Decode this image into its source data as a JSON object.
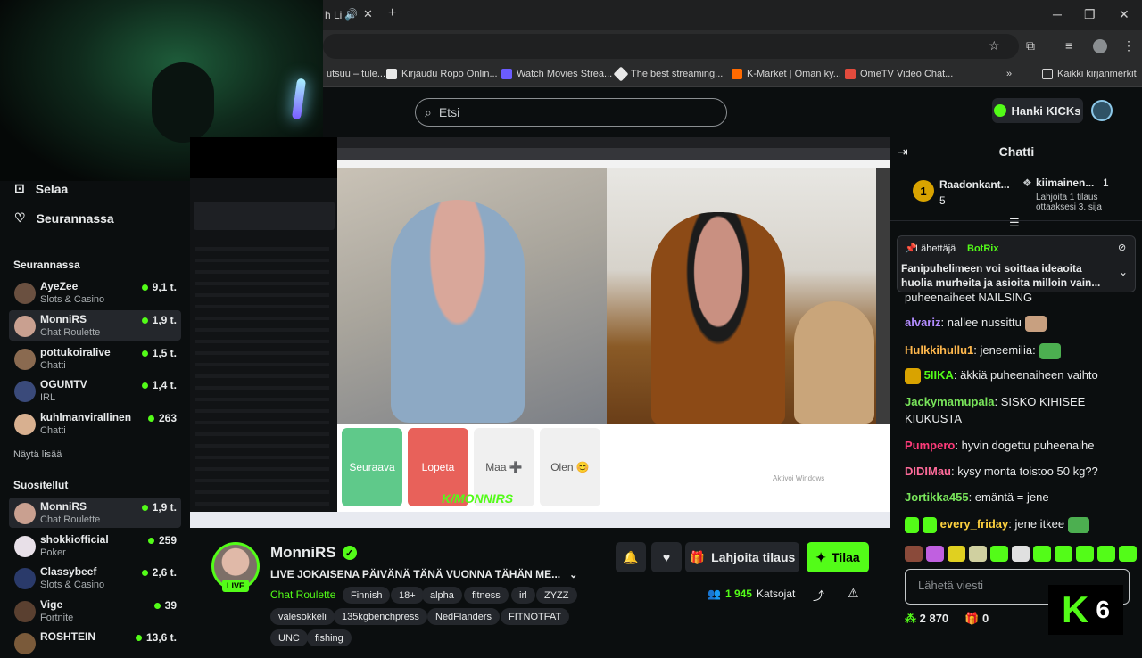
{
  "browser": {
    "tab_partial": "h Li",
    "bookmarks": [
      {
        "label": "utsuu – tule...",
        "color": "#3a3b3c"
      },
      {
        "label": "Kirjaudu Ropo Onlin...",
        "color": "#ffffff"
      },
      {
        "label": "Watch Movies Strea...",
        "color": "#6b5cff"
      },
      {
        "label": "The best streaming...",
        "color": "#ffffff"
      },
      {
        "label": "K-Market | Oman ky...",
        "color": "#ff6a00"
      },
      {
        "label": "OmeTV Video Chat...",
        "color": "#e34b3d"
      }
    ],
    "all_bookmarks": "Kaikki kirjanmerkit"
  },
  "site": {
    "search_placeholder": "Etsi",
    "get_kicks": "Hanki KICKs"
  },
  "sidebar": {
    "browse": "Selaa",
    "following": "Seurannassa",
    "following_header": "Seurannassa",
    "following_channels": [
      {
        "name": "AyeZee",
        "category": "Slots & Casino",
        "viewers": "9,1 t.",
        "color": "#6a5040"
      },
      {
        "name": "MonniRS",
        "category": "Chat Roulette",
        "viewers": "1,9 t.",
        "color": "#c9a090"
      },
      {
        "name": "pottukoiralive",
        "category": "Chatti",
        "viewers": "1,5 t.",
        "color": "#8a6a50"
      },
      {
        "name": "OGUMTV",
        "category": "IRL",
        "viewers": "1,4 t.",
        "color": "#3a4a7a"
      },
      {
        "name": "kuhlmanvirallinen",
        "category": "Chatti",
        "viewers": "263",
        "color": "#d8b090"
      }
    ],
    "show_more": "Näytä lisää",
    "recommended_header": "Suositellut",
    "recommended_channels": [
      {
        "name": "MonniRS",
        "category": "Chat Roulette",
        "viewers": "1,9 t.",
        "color": "#c9a090"
      },
      {
        "name": "shokkiofficial",
        "category": "Poker",
        "viewers": "259",
        "color": "#e8e0e8"
      },
      {
        "name": "Classybeef",
        "category": "Slots & Casino",
        "viewers": "2,6 t.",
        "color": "#2a3a6a"
      },
      {
        "name": "Vige",
        "category": "Fortnite",
        "viewers": "39",
        "color": "#5a4030"
      },
      {
        "name": "ROSHTEIN",
        "category": "",
        "viewers": "13,6 t.",
        "color": "#7a5a3a"
      }
    ]
  },
  "stream": {
    "ometv_buttons": [
      "Seuraava",
      "Lopeta",
      "Maa ➕",
      "Olen 😊"
    ],
    "watermark": "K/MONNIRS",
    "windows_activate": "Aktivoi Windows"
  },
  "info": {
    "name": "MonniRS",
    "live": "LIVE",
    "title": "LIVE JOKAISENA PÄIVÄNÄ TÄNÄ VUONNA TÄHÄN ME...",
    "category": "Chat Roulette",
    "tags_row1": [
      "Finnish",
      "18+",
      "alpha",
      "fitness",
      "irl",
      "ZYZZ"
    ],
    "tags_row2": [
      "valesokkeli",
      "135kgbenchpress",
      "NedFlanders",
      "FITNOTFAT"
    ],
    "tags_row3": [
      "UNC",
      "fishing"
    ],
    "gift_label": "Lahjoita tilaus",
    "subscribe_label": "Tilaa",
    "viewers_count": "1 945",
    "viewers_label": "Katsojat"
  },
  "chat": {
    "title": "Chatti",
    "leader1": {
      "name": "Raadonkant...",
      "count": "5"
    },
    "leader2": {
      "name": "kiimainen...",
      "count": "1",
      "sub": "Lahjoita 1 tilaus ottaaksesi 3. sija"
    },
    "pinned_by": "Lähettäjä",
    "pinned_user": "BotRix",
    "pinned_text": "Fanipuhelimeen voi soittaa ideaoita huolia murheita ja asioita milloin vain...",
    "partial_line": "puheenaiheet NAILSING",
    "messages": [
      {
        "user": "alvariz",
        "color": "#b38cff",
        "text": "nallee nussittu"
      },
      {
        "user": "Hulkkihullu1",
        "color": "#ffb84d",
        "text": "jeneemilia:"
      },
      {
        "user": "5IIKA",
        "color": "#53fc18",
        "text": "äkkiä puheenaiheen vaihto"
      },
      {
        "user": "Jackymamupala",
        "color": "#78e35a",
        "text": "SISKO KIHISEE KIUKUSTA"
      },
      {
        "user": "Pumpero",
        "color": "#ff3b7a",
        "text": "hyvin dogettu puheenaihe"
      },
      {
        "user": "DIDIMau",
        "color": "#ff6b9a",
        "text": "kysy monta toistoo 50 kg??"
      },
      {
        "user": "Jortikka455",
        "color": "#78e35a",
        "text": "emäntä = jene"
      },
      {
        "user": "every_friday",
        "color": "#ffd23f",
        "text": "jene itkee"
      }
    ],
    "input_placeholder": "Lähetä viesti",
    "kicks_balance": "2 870",
    "gift_count": "0",
    "badge_number": "6"
  }
}
